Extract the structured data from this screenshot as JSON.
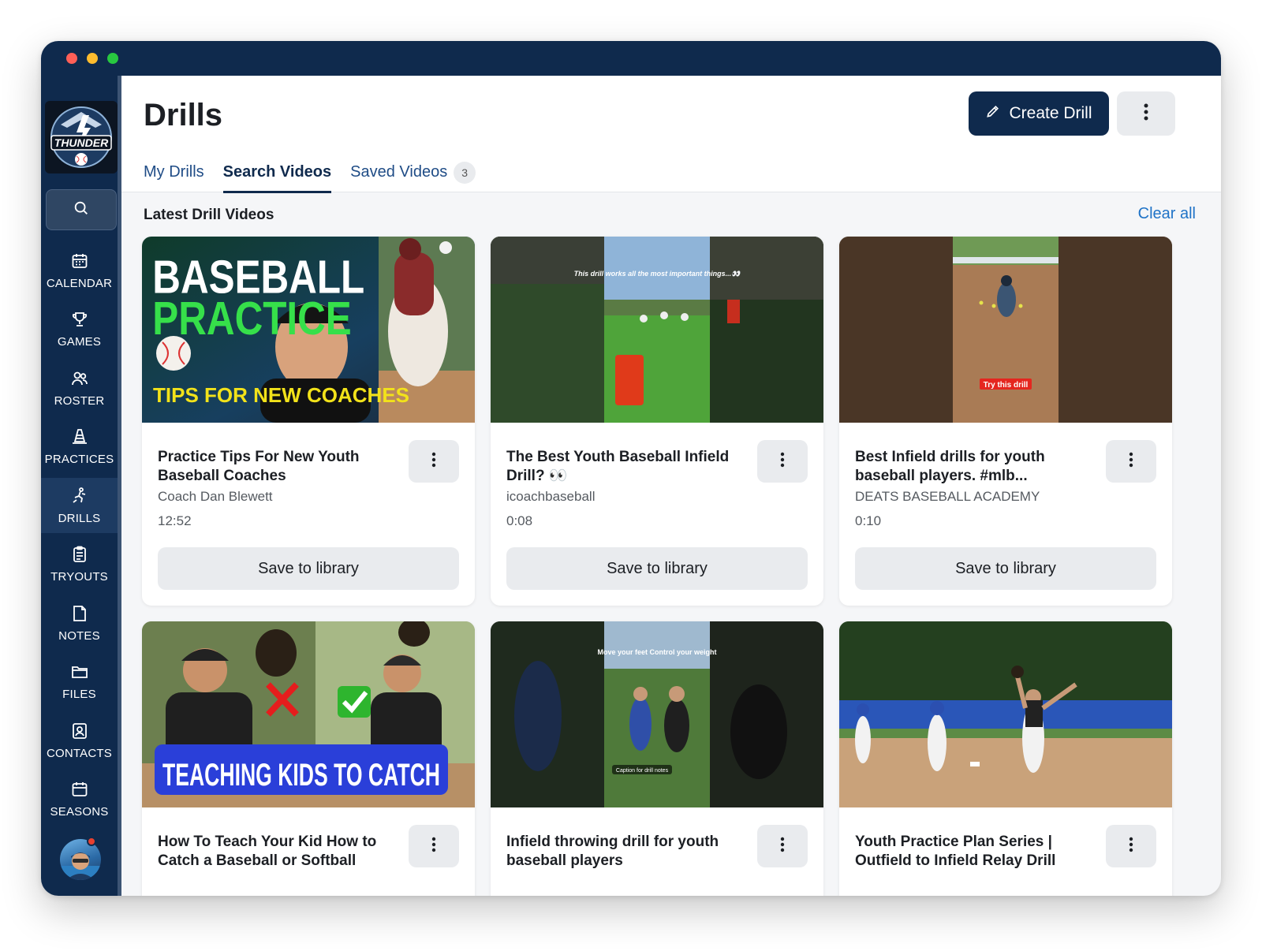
{
  "sidebar": {
    "logo_text": "THUNDER",
    "items": [
      {
        "label": "CALENDAR",
        "icon": "calendar-icon"
      },
      {
        "label": "GAMES",
        "icon": "trophy-icon"
      },
      {
        "label": "ROSTER",
        "icon": "people-icon"
      },
      {
        "label": "PRACTICES",
        "icon": "cone-icon"
      },
      {
        "label": "DRILLS",
        "icon": "drill-icon",
        "active": true
      },
      {
        "label": "TRYOUTS",
        "icon": "clipboard-icon"
      },
      {
        "label": "NOTES",
        "icon": "note-icon"
      },
      {
        "label": "FILES",
        "icon": "folder-icon"
      },
      {
        "label": "CONTACTS",
        "icon": "contact-card-icon"
      },
      {
        "label": "SEASONS",
        "icon": "calendar-icon"
      }
    ]
  },
  "header": {
    "title": "Drills",
    "create_label": "Create Drill",
    "tabs": [
      {
        "label": "My Drills"
      },
      {
        "label": "Search Videos",
        "active": true
      },
      {
        "label": "Saved Videos",
        "badge": "3"
      }
    ]
  },
  "section": {
    "title": "Latest Drill Videos",
    "clear_label": "Clear all"
  },
  "cards": [
    {
      "title": "Practice Tips For New Youth Baseball Coaches",
      "author": "Coach Dan Blewett",
      "duration": "12:52",
      "save_label": "Save to library",
      "thumb_text": {
        "line1": "BASEBALL",
        "line2": "PRACTICE",
        "line3": "TIPS FOR NEW COACHES"
      }
    },
    {
      "title": "The Best Youth Baseball Infield Drill? 👀",
      "author": "icoachbaseball",
      "duration": "0:08",
      "save_label": "Save to library",
      "thumb_text": {
        "caption": "This drill works all the most important things...👀"
      }
    },
    {
      "title": "Best Infield drills for youth baseball players. #mlb...",
      "author": "DEATS BASEBALL ACADEMY",
      "duration": "0:10",
      "save_label": "Save to library",
      "thumb_text": {
        "caption": "Try this drill"
      }
    },
    {
      "title": "How To Teach Your Kid How to Catch a Baseball or Softball",
      "author": "",
      "duration": "",
      "save_label": "",
      "thumb_text": {
        "banner": "TEACHING KIDS TO CATCH"
      }
    },
    {
      "title": "Infield throwing drill for youth baseball players",
      "author": "",
      "duration": "",
      "save_label": "",
      "thumb_text": {
        "caption": "Move your feet Control your weight",
        "sub": "Caption for drill notes"
      }
    },
    {
      "title": "Youth Practice Plan Series | Outfield to Infield Relay Drill",
      "author": "",
      "duration": "",
      "save_label": "",
      "thumb_text": {}
    }
  ]
}
